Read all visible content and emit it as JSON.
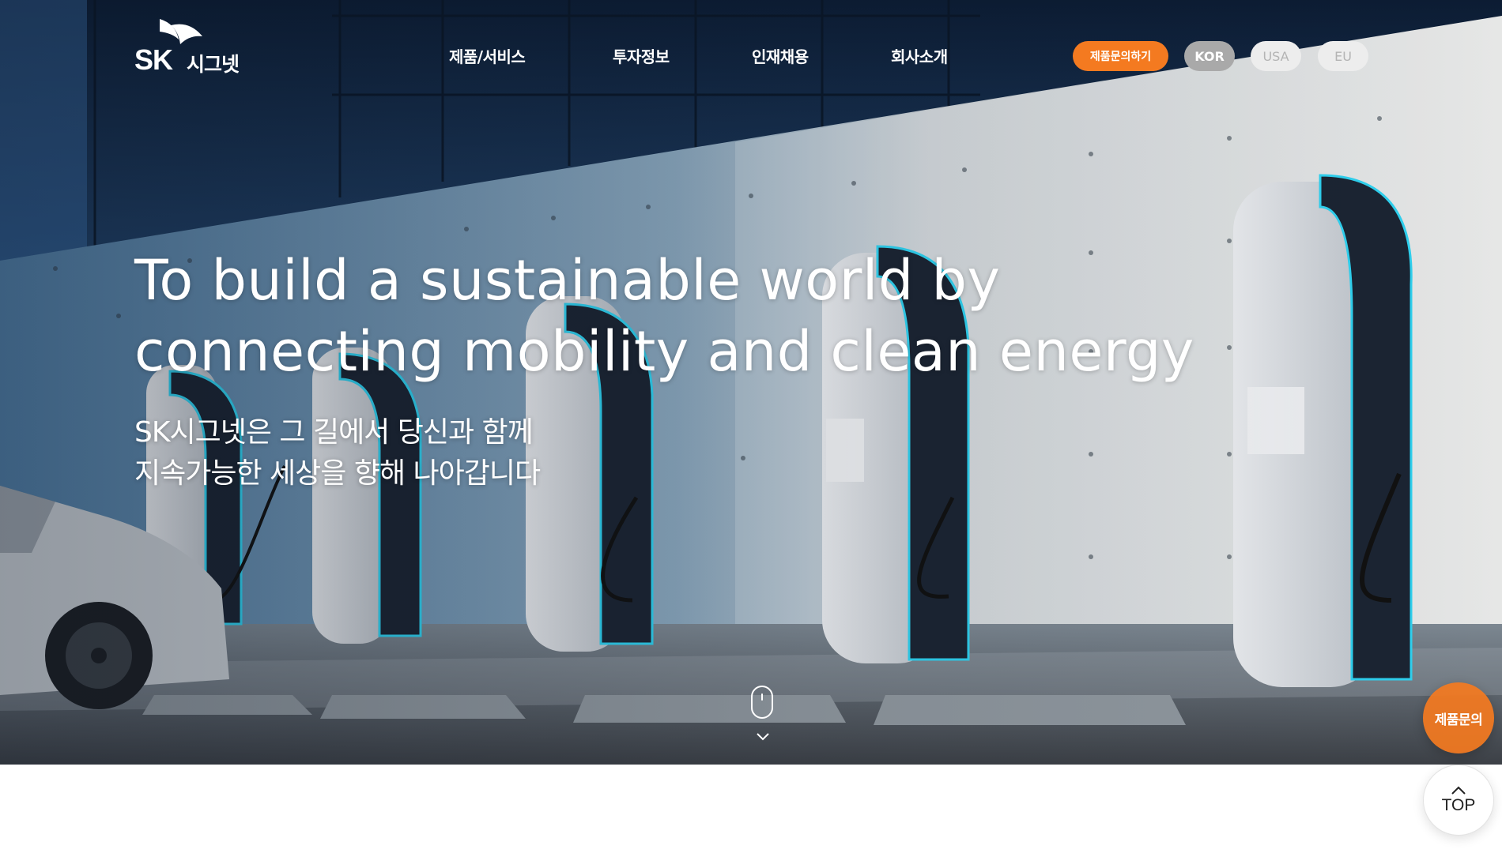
{
  "brand": {
    "logo_en": "SK",
    "logo_ko": "시그넷"
  },
  "nav": {
    "items": [
      {
        "label": "제품/서비스"
      },
      {
        "label": "투자정보"
      },
      {
        "label": "인재채용"
      },
      {
        "label": "회사소개"
      }
    ]
  },
  "header_actions": {
    "inquiry_label": "제품문의하기",
    "languages": [
      "KOR",
      "USA",
      "EU"
    ],
    "active_language": "KOR"
  },
  "hero": {
    "headline_line1": "To build a sustainable world by",
    "headline_line2": "connecting mobility and clean energy",
    "sub_line1": "SK시그넷은 그 길에서 당신과 함께",
    "sub_line2": "지속가능한 세상을 향해 나아갑니다"
  },
  "floating": {
    "inquiry_label": "제품문의",
    "top_label": "TOP"
  },
  "colors": {
    "accent_orange": "#f47a20",
    "charger_glow": "#2fd0ee",
    "active_lang_bg": "#a9a9a9",
    "inactive_lang_bg": "#ededed"
  }
}
